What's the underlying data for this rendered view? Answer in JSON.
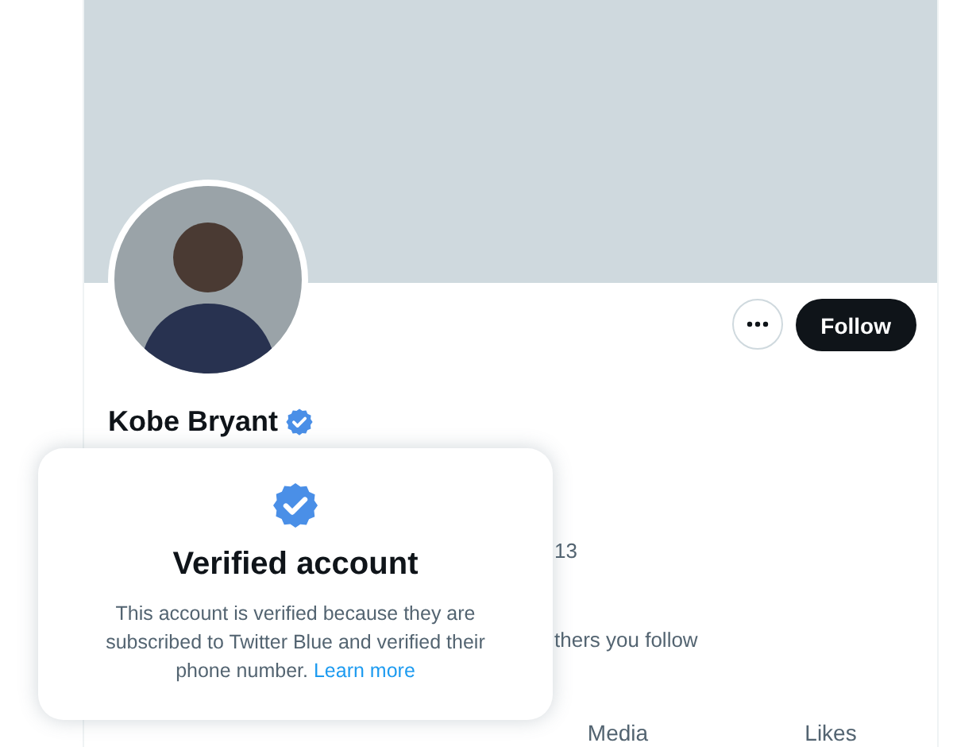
{
  "profile": {
    "name": "Kobe Bryant",
    "verified": true,
    "buttons": {
      "follow": "Follow"
    }
  },
  "fragments": {
    "stat": "13",
    "followers_note": "thers you follow"
  },
  "tabs": [
    {
      "label": "Media",
      "selected": false
    },
    {
      "label": "Likes",
      "selected": false
    }
  ],
  "popup": {
    "title": "Verified account",
    "body": "This account is verified because they are subscribed to Twitter Blue and verified their phone number.",
    "link": "Learn more"
  }
}
